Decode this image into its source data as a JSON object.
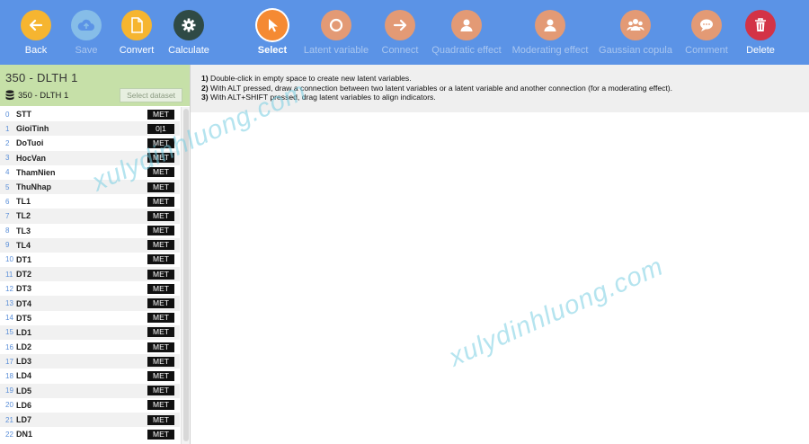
{
  "toolbar": {
    "buttons": [
      {
        "label": "Back",
        "icon": "arrow-left-icon",
        "color": "#f6b530",
        "state": "normal"
      },
      {
        "label": "Save",
        "icon": "cloud-upload-icon",
        "color": "#86bde8",
        "state": "disabled"
      },
      {
        "label": "Convert",
        "icon": "document-icon",
        "color": "#f6b530",
        "state": "normal"
      },
      {
        "label": "Calculate",
        "icon": "gear-icon",
        "color": "#2f4a45",
        "state": "normal"
      },
      {
        "label": "Select",
        "icon": "cursor-icon",
        "color": "#f58a33",
        "state": "active"
      },
      {
        "label": "Latent variable",
        "icon": "circle-icon",
        "color": "#e39a75",
        "state": "dim"
      },
      {
        "label": "Connect",
        "icon": "arrow-right-icon",
        "color": "#e39a75",
        "state": "dim"
      },
      {
        "label": "Quadratic effect",
        "icon": "user-icon",
        "color": "#e39a75",
        "state": "dim"
      },
      {
        "label": "Moderating effect",
        "icon": "user-icon",
        "color": "#e39a75",
        "state": "dim"
      },
      {
        "label": "Gaussian copula",
        "icon": "users-icon",
        "color": "#e39a75",
        "state": "dim"
      },
      {
        "label": "Comment",
        "icon": "comment-icon",
        "color": "#e39a75",
        "state": "dim"
      },
      {
        "label": "Delete",
        "icon": "trash-icon",
        "color": "#d33346",
        "state": "normal"
      }
    ]
  },
  "dataset": {
    "title": "350 - DLTH 1",
    "name": "350 - DLTH 1",
    "select_label": "Select dataset"
  },
  "variables": [
    {
      "idx": "0",
      "name": "STT",
      "type": "MET"
    },
    {
      "idx": "1",
      "name": "GioiTinh",
      "type": "0|1"
    },
    {
      "idx": "2",
      "name": "DoTuoi",
      "type": "MET"
    },
    {
      "idx": "3",
      "name": "HocVan",
      "type": "MET"
    },
    {
      "idx": "4",
      "name": "ThamNien",
      "type": "MET"
    },
    {
      "idx": "5",
      "name": "ThuNhap",
      "type": "MET"
    },
    {
      "idx": "6",
      "name": "TL1",
      "type": "MET"
    },
    {
      "idx": "7",
      "name": "TL2",
      "type": "MET"
    },
    {
      "idx": "8",
      "name": "TL3",
      "type": "MET"
    },
    {
      "idx": "9",
      "name": "TL4",
      "type": "MET"
    },
    {
      "idx": "10",
      "name": "DT1",
      "type": "MET"
    },
    {
      "idx": "11",
      "name": "DT2",
      "type": "MET"
    },
    {
      "idx": "12",
      "name": "DT3",
      "type": "MET"
    },
    {
      "idx": "13",
      "name": "DT4",
      "type": "MET"
    },
    {
      "idx": "14",
      "name": "DT5",
      "type": "MET"
    },
    {
      "idx": "15",
      "name": "LD1",
      "type": "MET"
    },
    {
      "idx": "16",
      "name": "LD2",
      "type": "MET"
    },
    {
      "idx": "17",
      "name": "LD3",
      "type": "MET"
    },
    {
      "idx": "18",
      "name": "LD4",
      "type": "MET"
    },
    {
      "idx": "19",
      "name": "LD5",
      "type": "MET"
    },
    {
      "idx": "20",
      "name": "LD6",
      "type": "MET"
    },
    {
      "idx": "21",
      "name": "LD7",
      "type": "MET"
    },
    {
      "idx": "22",
      "name": "DN1",
      "type": "MET"
    }
  ],
  "instructions": [
    {
      "num": "1)",
      "text": "Double-click in empty space to create new latent variables."
    },
    {
      "num": "2)",
      "text": "With ALT pressed, draw a connection between two latent variables or a latent variable and another connection (for a moderating effect)."
    },
    {
      "num": "3)",
      "text": "With ALT+SHIFT pressed, drag latent variables to align indicators."
    }
  ],
  "watermark": "xulydinhluong.com"
}
